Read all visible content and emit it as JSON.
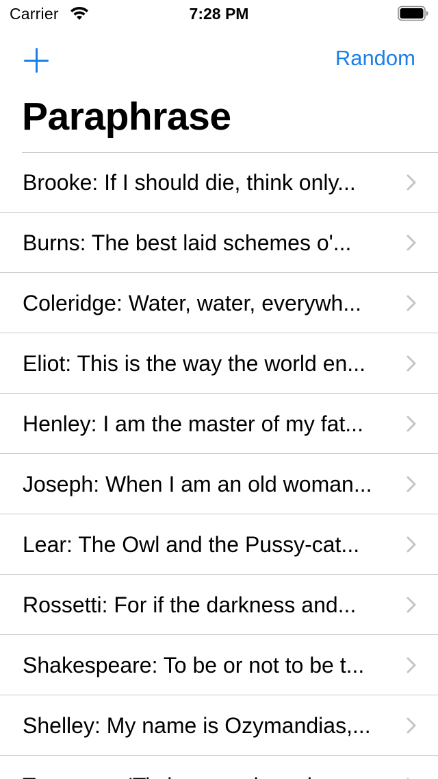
{
  "status_bar": {
    "carrier": "Carrier",
    "time": "7:28 PM",
    "icons": [
      "wifi-icon",
      "battery-icon"
    ]
  },
  "nav": {
    "add_icon": "plus-icon",
    "random_label": "Random",
    "title": "Paraphrase"
  },
  "colors": {
    "accent": "#1a7fe8",
    "separator": "#c8c7cc",
    "chevron": "#c4c4c7"
  },
  "list": {
    "items": [
      {
        "label": "Brooke: If I should die, think only..."
      },
      {
        "label": "Burns: The best laid schemes o'..."
      },
      {
        "label": "Coleridge: Water, water, everywh..."
      },
      {
        "label": "Eliot: This is the way the world en..."
      },
      {
        "label": "Henley: I am the master of my fat..."
      },
      {
        "label": "Joseph: When I am an old woman..."
      },
      {
        "label": "Lear: The Owl and the Pussy-cat..."
      },
      {
        "label": "Rossetti: For if the darkness and..."
      },
      {
        "label": "Shakespeare: To be or not to be t..."
      },
      {
        "label": "Shelley: My name is Ozymandias,..."
      },
      {
        "label": "Tennyson: 'Tis better to have lov..."
      }
    ]
  }
}
